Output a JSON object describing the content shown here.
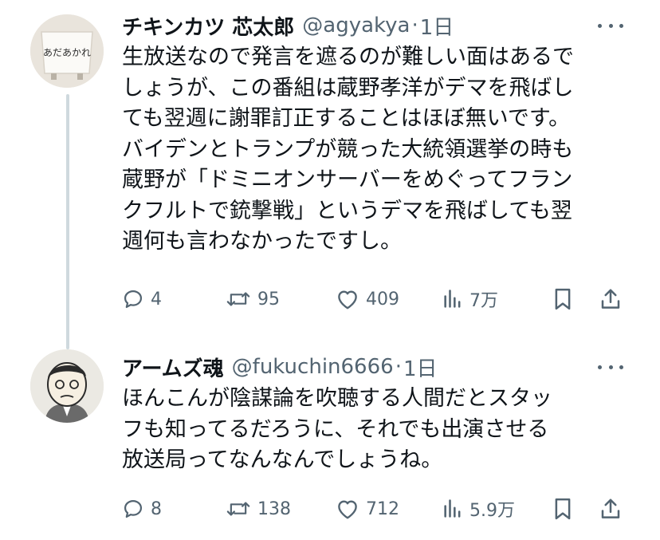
{
  "tweets": [
    {
      "display_name": "チキンカツ 芯太郎",
      "handle": "@agyakya",
      "separator": "·",
      "time": "1日",
      "avatar_text": "あだあかれ",
      "text_lines": [
        "生放送なので発言を遮るのが難しい面はあるで",
        "しょうが、この番組は蔵野孝洋がデマを飛ばし",
        "ても翌週に謝罪訂正することはほぼ無いです。",
        "バイデンとトランプが競った大統領選挙の時も",
        "蔵野が「ドミニオンサーバーをめぐってフラン",
        "クフルトで銃撃戦」というデマを飛ばしても翌",
        "週何も言わなかったですし。"
      ],
      "replies": "4",
      "retweets": "95",
      "likes": "409",
      "views": "7万"
    },
    {
      "display_name": "アームズ魂",
      "handle": "@fukuchin6666",
      "separator": "·",
      "time": "1日",
      "text_lines": [
        "ほんこんが陰謀論を吹聴する人間だとスタッ",
        "フも知ってるだろうに、それでも出演させる",
        "放送局ってなんなんでしょうね。"
      ],
      "replies": "8",
      "retweets": "138",
      "likes": "712",
      "views": "5.9万"
    }
  ],
  "icons": [
    "reply-icon",
    "retweet-icon",
    "like-icon",
    "views-icon",
    "bookmark-icon",
    "share-icon",
    "more-icon"
  ],
  "colors": {
    "text": "#0f1419",
    "secondary": "#536471",
    "thread_line": "#cfd9de"
  }
}
